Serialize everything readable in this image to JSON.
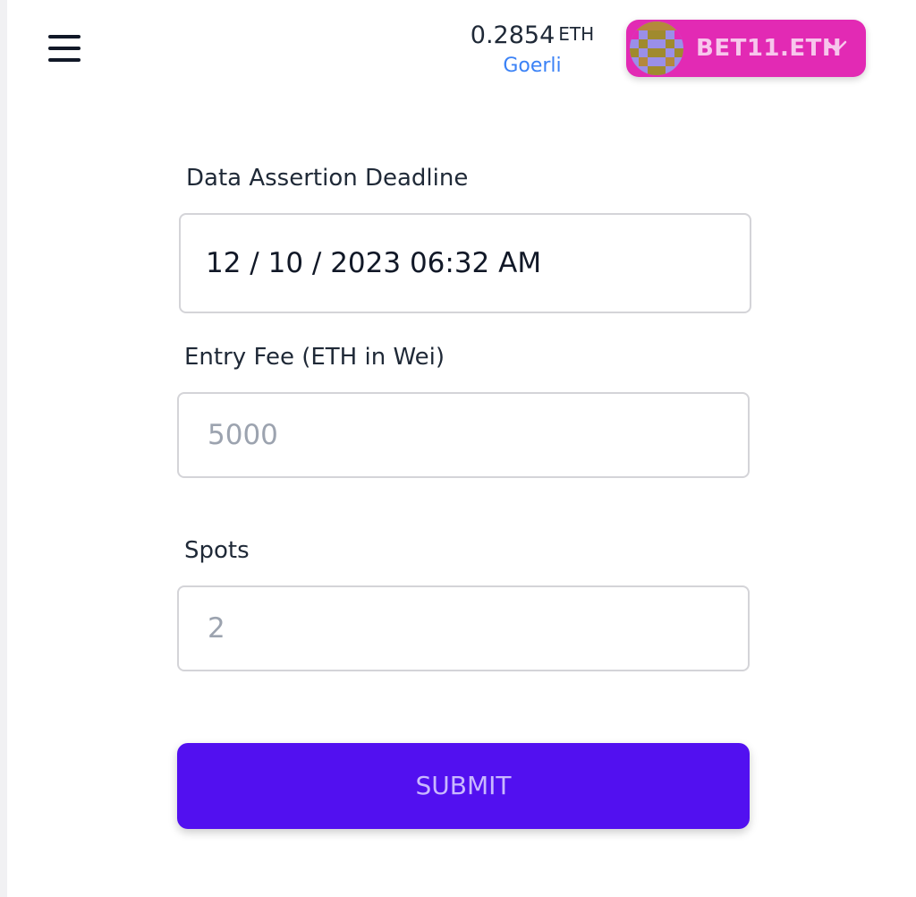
{
  "header": {
    "menu_icon": "hamburger-menu-icon",
    "balance": {
      "amount": "0.2854",
      "unit": "ETH",
      "network": "Goerli"
    },
    "account": {
      "label": "BET11.ETH",
      "avatar_icon": "pixel-avatar-icon",
      "chevron_icon": "chevron-down-icon",
      "accent_color": "#e22ab4"
    }
  },
  "form": {
    "deadline": {
      "label": "Data Assertion Deadline",
      "value": "12 / 10 / 2023 06:32 AM"
    },
    "entry_fee": {
      "label": "Entry Fee (ETH in Wei)",
      "placeholder": "5000"
    },
    "spots": {
      "label": "Spots",
      "placeholder": "2"
    },
    "submit_label": "SUBMIT",
    "submit_color": "#5210f0"
  }
}
